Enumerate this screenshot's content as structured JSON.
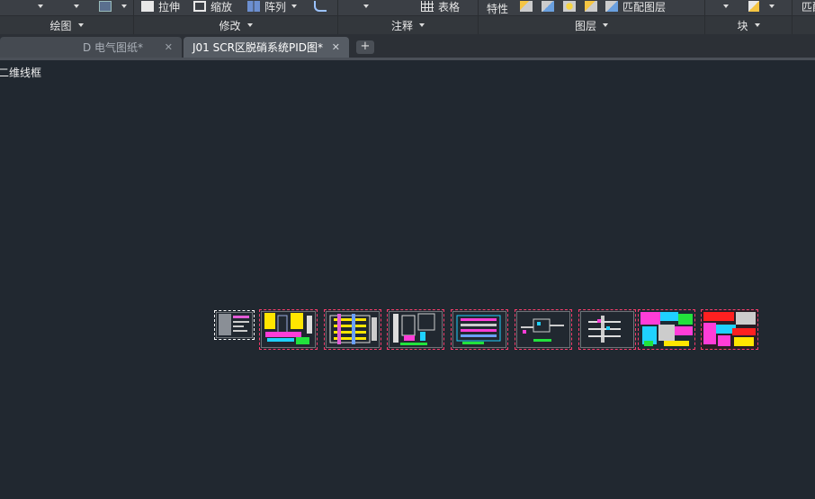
{
  "ribbon": {
    "top_buttons": {
      "stretch": "拉伸",
      "scale": "缩放",
      "array": "阵列",
      "table": "表格",
      "properties": "特性",
      "match_layer": "匹配图层",
      "match_cut": "匹配"
    },
    "panels": {
      "draw": "绘图",
      "modify": "修改",
      "annotation": "注释",
      "layers": "图层",
      "block": "块"
    }
  },
  "tabs": [
    {
      "label": "D 电气图纸*",
      "close": "✕"
    },
    {
      "label": "J01 SCR区脱硝系统PID图*",
      "close": "✕"
    }
  ],
  "add_tab": "+",
  "canvas": {
    "view_label": "二维线框",
    "sheet_count": 9
  },
  "colors": {
    "background": "#212830",
    "sheet_border": "#ff3d6e"
  }
}
